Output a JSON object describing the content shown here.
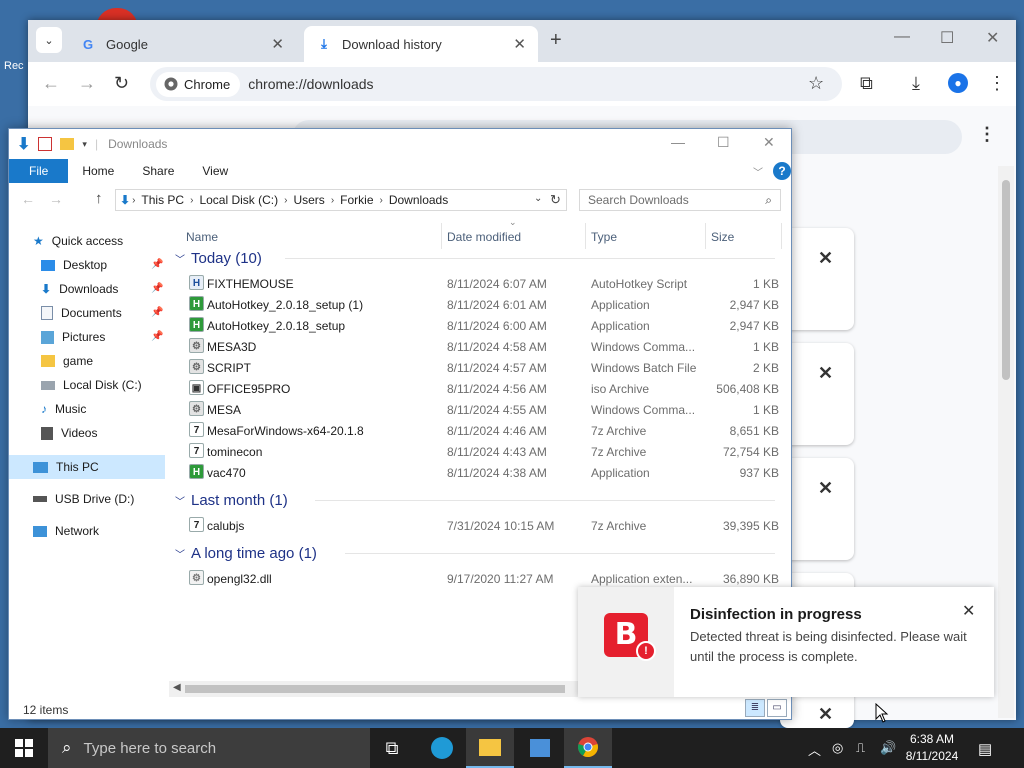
{
  "desktop": {
    "recycle_label": "Rec"
  },
  "chrome": {
    "tabs": [
      {
        "title": "Google",
        "icon": "google-g-icon"
      },
      {
        "title": "Download history",
        "icon": "download-icon"
      }
    ],
    "omnibox": {
      "chip": "Chrome",
      "url": "chrome://downloads"
    }
  },
  "explorer": {
    "title": "Downloads",
    "ribbon_tabs": [
      "File",
      "Home",
      "Share",
      "View"
    ],
    "address": [
      "This PC",
      "Local Disk (C:)",
      "Users",
      "Forkie",
      "Downloads"
    ],
    "search_placeholder": "Search Downloads",
    "nav": [
      {
        "label": "Quick access",
        "icon": "star-icon"
      },
      {
        "label": "Desktop",
        "icon": "desktop-icon"
      },
      {
        "label": "Downloads",
        "icon": "download-arrow-icon"
      },
      {
        "label": "Documents",
        "icon": "document-icon"
      },
      {
        "label": "Pictures",
        "icon": "picture-icon"
      },
      {
        "label": "game",
        "icon": "folder-icon"
      },
      {
        "label": "Local Disk (C:)",
        "icon": "drive-icon"
      },
      {
        "label": "Music",
        "icon": "music-icon"
      },
      {
        "label": "Videos",
        "icon": "video-icon"
      },
      {
        "label": "This PC",
        "icon": "computer-icon"
      },
      {
        "label": "USB Drive (D:)",
        "icon": "usb-drive-icon"
      },
      {
        "label": "Network",
        "icon": "network-icon"
      }
    ],
    "columns": [
      "Name",
      "Date modified",
      "Type",
      "Size"
    ],
    "groups": [
      {
        "label": "Today (10)",
        "files": [
          {
            "name": "FIXTHEMOUSE",
            "date": "8/11/2024 6:07 AM",
            "type": "AutoHotkey Script",
            "size": "1 KB"
          },
          {
            "name": "AutoHotkey_2.0.18_setup (1)",
            "date": "8/11/2024 6:01 AM",
            "type": "Application",
            "size": "2,947 KB"
          },
          {
            "name": "AutoHotkey_2.0.18_setup",
            "date": "8/11/2024 6:00 AM",
            "type": "Application",
            "size": "2,947 KB"
          },
          {
            "name": "MESA3D",
            "date": "8/11/2024 4:58 AM",
            "type": "Windows Comma...",
            "size": "1 KB"
          },
          {
            "name": "SCRIPT",
            "date": "8/11/2024 4:57 AM",
            "type": "Windows Batch File",
            "size": "2 KB"
          },
          {
            "name": "OFFICE95PRO",
            "date": "8/11/2024 4:56 AM",
            "type": "iso Archive",
            "size": "506,408 KB"
          },
          {
            "name": "MESA",
            "date": "8/11/2024 4:55 AM",
            "type": "Windows Comma...",
            "size": "1 KB"
          },
          {
            "name": "MesaForWindows-x64-20.1.8",
            "date": "8/11/2024 4:46 AM",
            "type": "7z Archive",
            "size": "8,651 KB"
          },
          {
            "name": "tominecon",
            "date": "8/11/2024 4:43 AM",
            "type": "7z Archive",
            "size": "72,754 KB"
          },
          {
            "name": "vac470",
            "date": "8/11/2024 4:38 AM",
            "type": "Application",
            "size": "937 KB"
          }
        ]
      },
      {
        "label": "Last month (1)",
        "files": [
          {
            "name": "calubjs",
            "date": "7/31/2024 10:15 AM",
            "type": "7z Archive",
            "size": "39,395 KB"
          }
        ]
      },
      {
        "label": "A long time ago (1)",
        "files": [
          {
            "name": "opengl32.dll",
            "date": "9/17/2020 11:27 AM",
            "type": "Application exten...",
            "size": "36,890 KB"
          }
        ]
      }
    ],
    "status": "12 items"
  },
  "toast": {
    "title": "Disinfection in progress",
    "message": "Detected threat is being disinfected. Please wait until the process is complete.",
    "logo_letter": "B",
    "brand_color": "#e5202e"
  },
  "taskbar": {
    "search_placeholder": "Type here to search",
    "time": "6:38 AM",
    "date": "8/11/2024"
  }
}
